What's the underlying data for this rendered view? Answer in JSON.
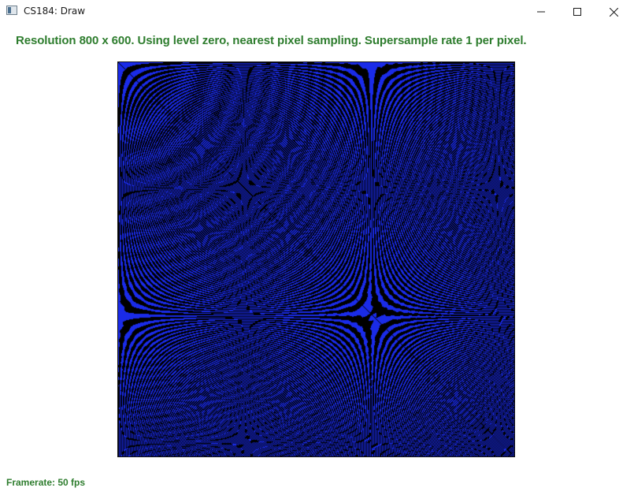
{
  "window": {
    "title": "CS184: Draw",
    "controls": {
      "minimize_icon": "minimize-icon",
      "maximize_icon": "maximize-icon",
      "close_icon": "close-icon"
    }
  },
  "header": {
    "status": "Resolution 800 x 600. Using level zero, nearest pixel sampling. Supersample rate 1 per pixel."
  },
  "footer": {
    "framerate": "Framerate: 50 fps"
  },
  "colors": {
    "status_text": "#2e7d2e",
    "render_background": "#000000",
    "render_line": "#1a2be8"
  }
}
